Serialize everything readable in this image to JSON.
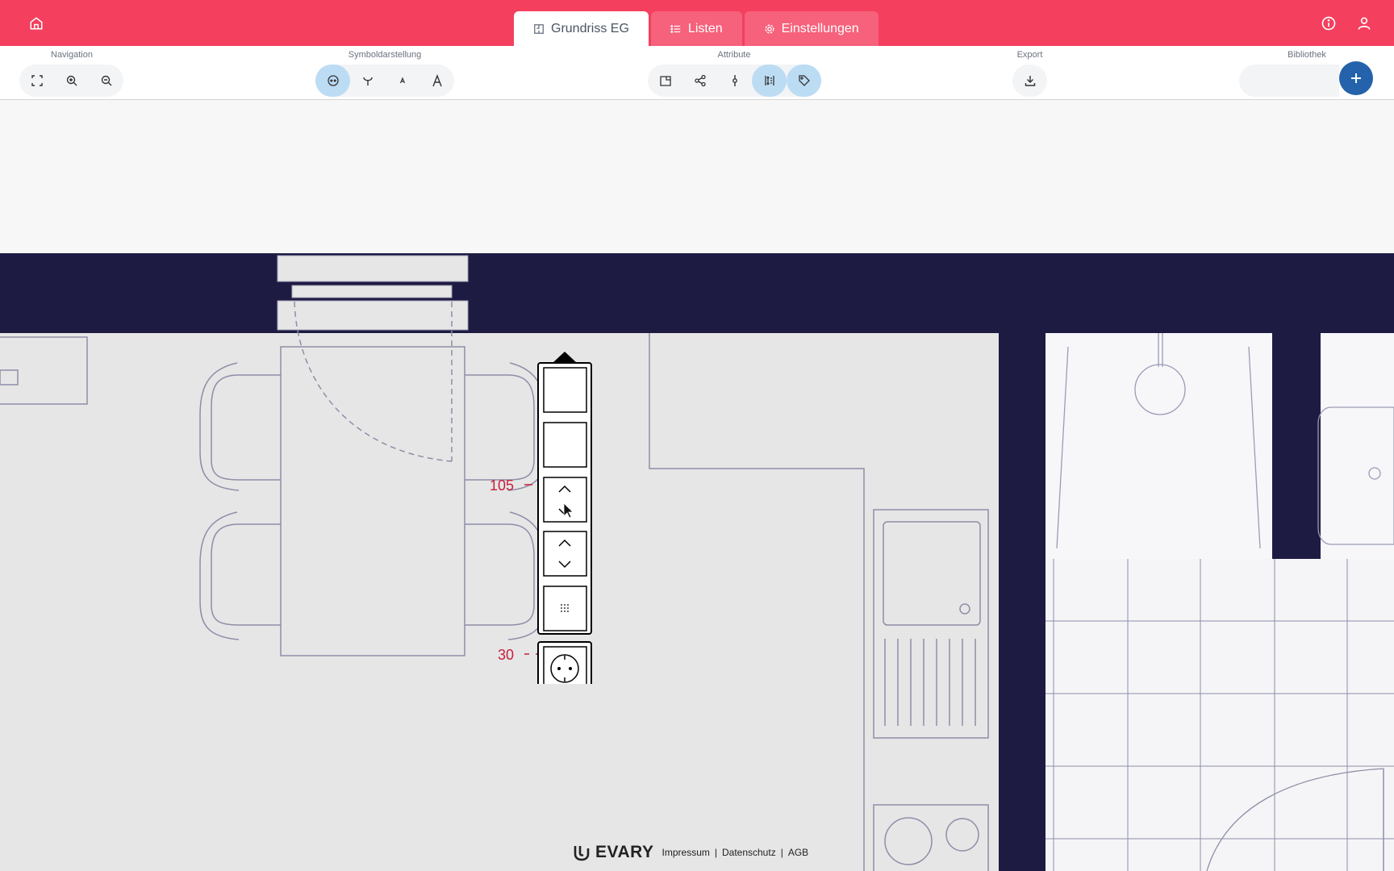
{
  "header": {
    "tabs": [
      {
        "label": "Grundriss EG",
        "icon": "floorplan-icon",
        "active": true
      },
      {
        "label": "Listen",
        "icon": "list-icon",
        "active": false
      },
      {
        "label": "Einstellungen",
        "icon": "gear-icon",
        "active": false
      }
    ],
    "accent_color": "#f43f5e"
  },
  "toolbar": {
    "navigation_label": "Navigation",
    "symbol_label": "Symboldarstellung",
    "attribute_label": "Attribute",
    "export_label": "Export",
    "library_label": "Bibliothek"
  },
  "canvas": {
    "dimensions": [
      {
        "value": "105"
      },
      {
        "value": "30"
      }
    ]
  },
  "footer": {
    "brand": "EVARY",
    "links": [
      "Impressum",
      "Datenschutz",
      "AGB"
    ]
  }
}
